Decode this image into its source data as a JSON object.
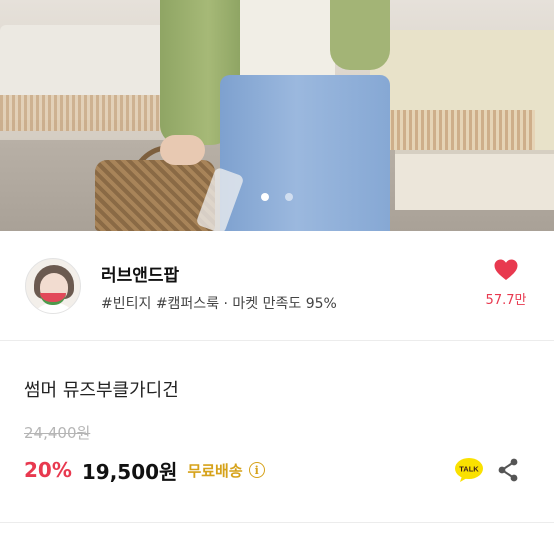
{
  "gallery": {
    "image_alt": "",
    "slide_count": 2,
    "active_index": 0
  },
  "shop": {
    "name": "러브앤드팝",
    "tags": "#빈티지 #캠퍼스룩 · 마켓 만족도 95%",
    "like_count": "57.7만"
  },
  "product": {
    "title": "썸머 뮤즈부클가디건",
    "original_price": "24,400원",
    "discount": "20%",
    "price": "19,500원",
    "shipping_label": "무료배송",
    "info_glyph": "i",
    "talk_label": "TALK"
  },
  "colors": {
    "accent_red": "#e8394f",
    "shipping_gold": "#d6a21a",
    "talk_yellow": "#fae100"
  },
  "icons": {
    "like": "heart-icon",
    "info": "info-icon",
    "talk": "kakao-talk-icon",
    "share": "share-icon"
  }
}
